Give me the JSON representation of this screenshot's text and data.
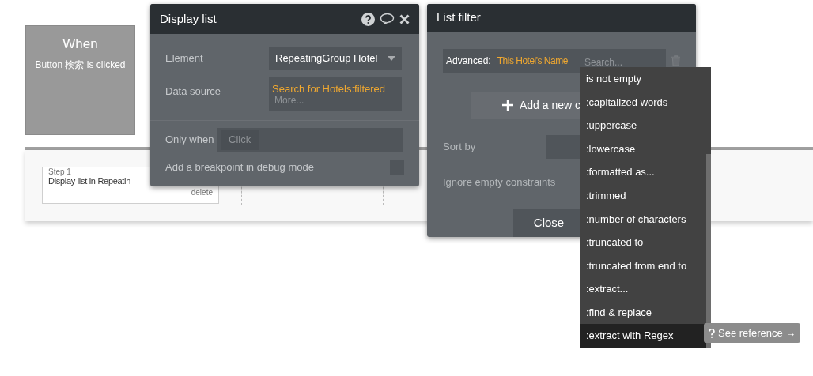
{
  "trigger": {
    "title": "When",
    "event": "Button 検索 is clicked"
  },
  "step": {
    "label": "Step 1",
    "text": "Display list in Repeatin",
    "delete": "delete"
  },
  "display_list": {
    "title": "Display list",
    "element_label": "Element",
    "element_value": "RepeatingGroup Hotel",
    "data_source_label": "Data source",
    "data_source_value": "Search for Hotels:filtered",
    "more": "More...",
    "only_when_label": "Only when",
    "only_when_placeholder": "Click",
    "breakpoint_label": "Add a breakpoint in debug mode",
    "breakpoint_checked": false
  },
  "list_filter": {
    "title": "List filter",
    "advanced_label": "Advanced:",
    "advanced_value": "This Hotel's Name",
    "search_placeholder": "Search...",
    "add_button": "Add a new c",
    "sort_by_label": "Sort by",
    "ignore_label": "Ignore empty constraints",
    "close_button": "Close"
  },
  "menu": {
    "items": [
      {
        "label": "is not empty",
        "selected": false
      },
      {
        "label": ":capitalized words",
        "selected": false
      },
      {
        "label": ":uppercase",
        "selected": false
      },
      {
        "label": ":lowercase",
        "selected": false
      },
      {
        "label": ":formatted as...",
        "selected": false
      },
      {
        "label": ":trimmed",
        "selected": false
      },
      {
        "label": ":number of characters",
        "selected": false
      },
      {
        "label": ":truncated to",
        "selected": false
      },
      {
        "label": ":truncated from end to",
        "selected": false
      },
      {
        "label": ":extract...",
        "selected": false
      },
      {
        "label": ":find & replace",
        "selected": false
      },
      {
        "label": ":extract with Regex",
        "selected": true
      }
    ]
  },
  "tooltip": "See reference →"
}
